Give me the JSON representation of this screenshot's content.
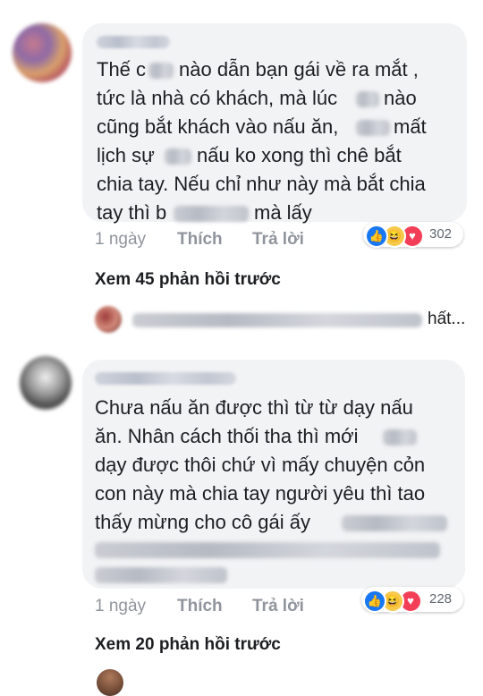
{
  "colors": {
    "bubble": "#f2f3f5",
    "action_text": "#90949c",
    "like_blue": "#1877f2",
    "haha_yellow": "#f7c94b",
    "love_red": "#f33e58"
  },
  "comments": [
    {
      "lines": [
        "Thế c",
        "nào dẫn bạn gái về ra mắt ,",
        "tức là nhà có khách, mà lúc",
        "nào",
        "cũng bắt khách vào nấu ăn,",
        "mất",
        "lịch sự",
        "nấu ko xong thì chê bắt",
        "chia tay. Nếu chỉ như này mà bắt chia",
        "tay thì b",
        "mà lấy"
      ],
      "time": "1 ngày",
      "like_label": "Thích",
      "reply_label": "Trả lời",
      "reaction_icons": [
        "like-icon",
        "haha-icon",
        "love-icon"
      ],
      "reaction_count": "302"
    },
    {
      "lines": [
        "Chưa nấu ăn được thì từ từ dạy nấu",
        "ăn. Nhân cách thối tha thì mới",
        "dạy được thôi chứ vì mấy chuyện cỏn",
        "con này mà chia tay người yêu thì tao",
        "thấy mừng cho cô gái ấy"
      ],
      "time": "1 ngày",
      "like_label": "Thích",
      "reply_label": "Trả lời",
      "reaction_icons": [
        "like-icon",
        "haha-icon",
        "love-icon"
      ],
      "reaction_count": "228"
    }
  ],
  "see_more_1": "Xem 45 phản hồi trước",
  "collapsed_reply_tail": "hất...",
  "see_more_2": "Xem 20 phản hồi trước"
}
